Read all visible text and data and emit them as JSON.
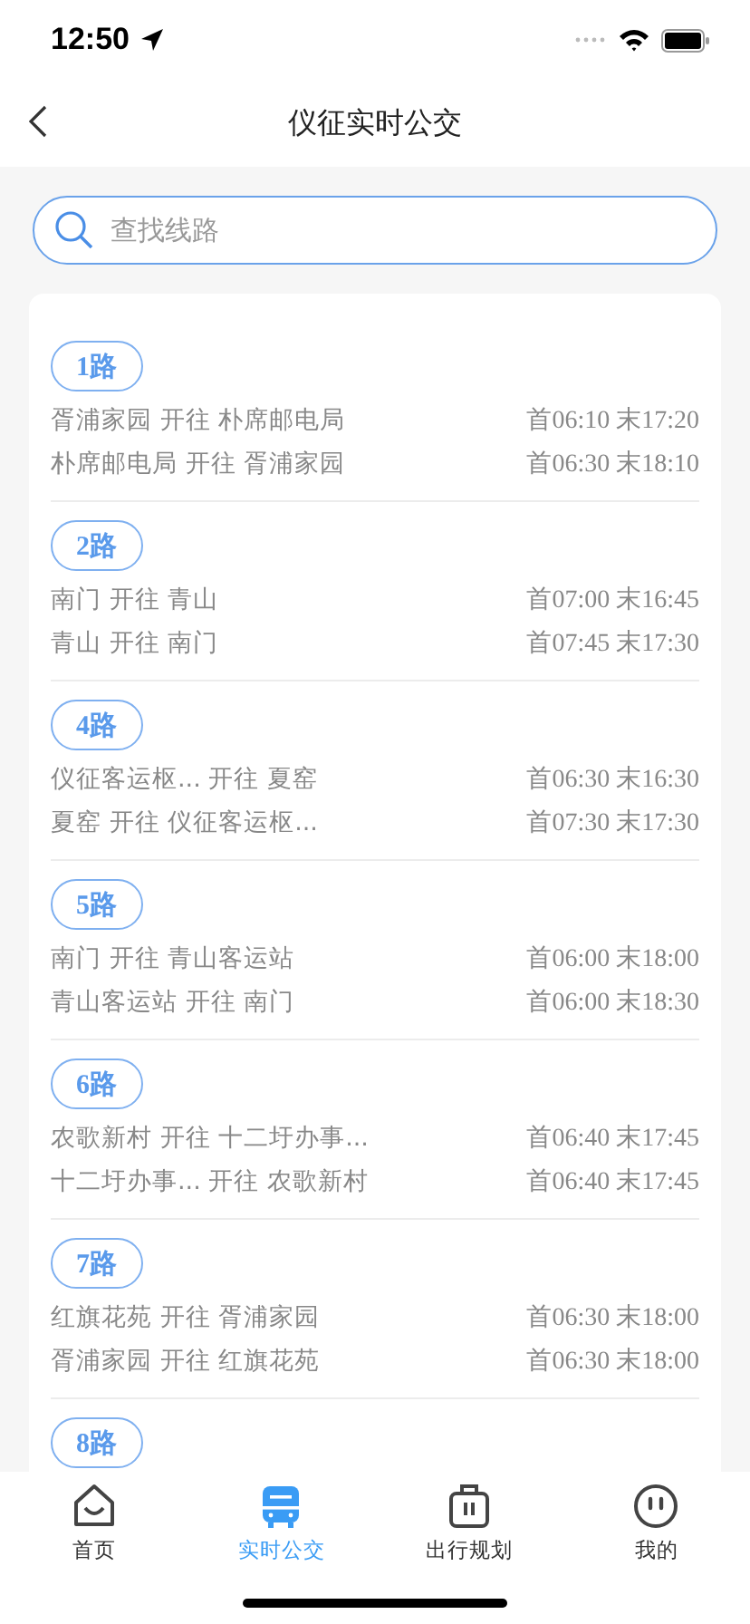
{
  "status_bar": {
    "time": "12:50"
  },
  "nav_bar": {
    "title": "仪征实时公交"
  },
  "search": {
    "placeholder": "查找线路"
  },
  "routes": [
    {
      "name": "1路",
      "directions": [
        {
          "route": "胥浦家园 开往 朴席邮电局",
          "times": "首06:10 末17:20"
        },
        {
          "route": "朴席邮电局 开往 胥浦家园",
          "times": "首06:30 末18:10"
        }
      ]
    },
    {
      "name": "2路",
      "directions": [
        {
          "route": "南门 开往 青山",
          "times": "首07:00 末16:45"
        },
        {
          "route": "青山 开往 南门",
          "times": "首07:45 末17:30"
        }
      ]
    },
    {
      "name": "4路",
      "directions": [
        {
          "route": "仪征客运枢... 开往 夏窑",
          "times": "首06:30 末16:30"
        },
        {
          "route": "夏窑 开往 仪征客运枢...",
          "times": "首07:30 末17:30"
        }
      ]
    },
    {
      "name": "5路",
      "directions": [
        {
          "route": "南门 开往 青山客运站",
          "times": "首06:00 末18:00"
        },
        {
          "route": "青山客运站 开往 南门",
          "times": "首06:00 末18:30"
        }
      ]
    },
    {
      "name": "6路",
      "directions": [
        {
          "route": "农歌新村 开往 十二圩办事...",
          "times": "首06:40 末17:45"
        },
        {
          "route": "十二圩办事... 开往 农歌新村",
          "times": "首06:40 末17:45"
        }
      ]
    },
    {
      "name": "7路",
      "directions": [
        {
          "route": "红旗花苑 开往 胥浦家园",
          "times": "首06:30 末18:00"
        },
        {
          "route": "胥浦家园 开往 红旗花苑",
          "times": "首06:30 末18:00"
        }
      ]
    },
    {
      "name": "8路"
    }
  ],
  "tab_bar": [
    {
      "kind": "home",
      "label": "首页",
      "selected": false
    },
    {
      "kind": "bus",
      "label": "实时公交",
      "selected": true
    },
    {
      "kind": "plan",
      "label": "出行规划",
      "selected": false
    },
    {
      "kind": "profile",
      "label": "我的",
      "selected": false
    }
  ]
}
